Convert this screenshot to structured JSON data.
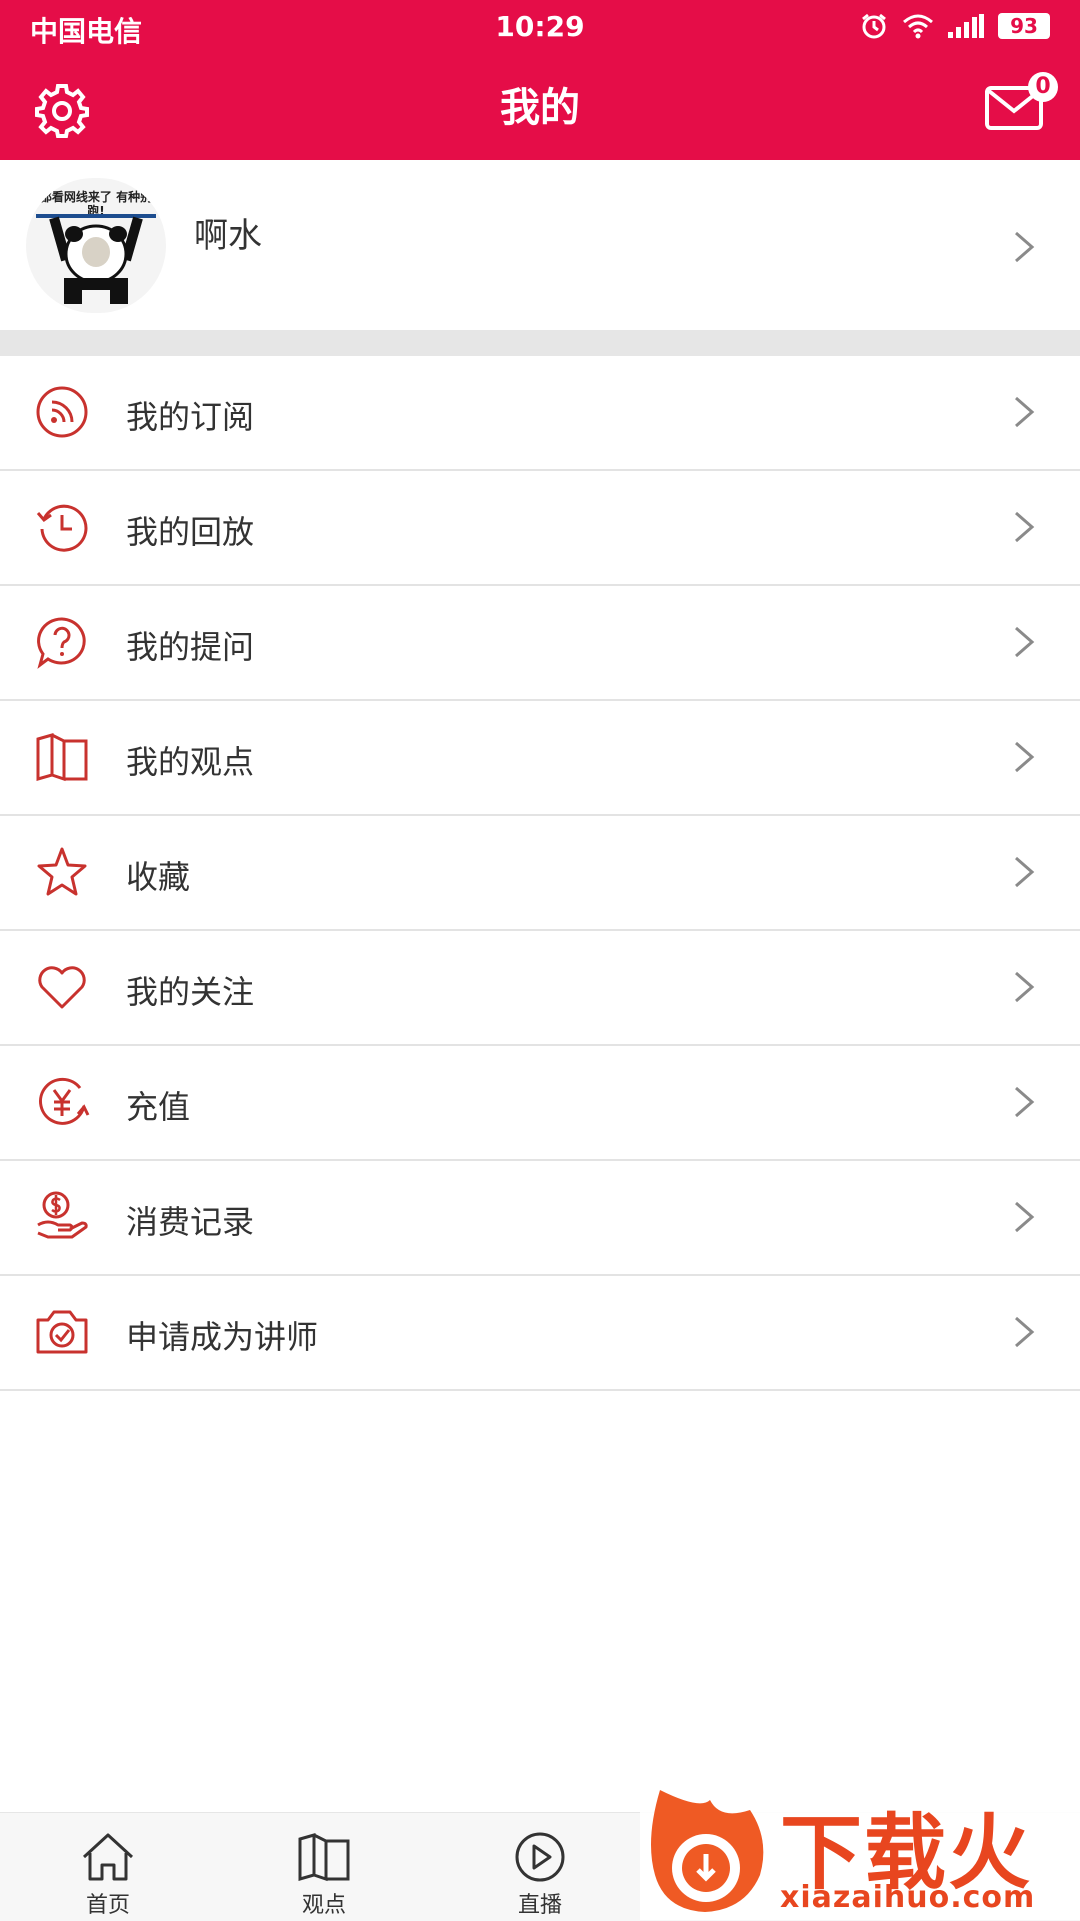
{
  "status_bar": {
    "carrier": "中国电信",
    "time": "10:29",
    "battery": "93"
  },
  "header": {
    "title": "我的",
    "mail_count": "0"
  },
  "profile": {
    "name": "啊水",
    "avatar_caption": "都看网线来了 有种别跑!"
  },
  "menu": [
    {
      "label": "我的订阅",
      "icon": "rss-icon"
    },
    {
      "label": "我的回放",
      "icon": "history-icon"
    },
    {
      "label": "我的提问",
      "icon": "question-icon"
    },
    {
      "label": "我的观点",
      "icon": "book-icon"
    },
    {
      "label": "收藏",
      "icon": "star-icon"
    },
    {
      "label": "我的关注",
      "icon": "heart-icon"
    },
    {
      "label": "充值",
      "icon": "yuan-icon"
    },
    {
      "label": "消费记录",
      "icon": "money-hand-icon"
    },
    {
      "label": "申请成为讲师",
      "icon": "camera-check-icon"
    }
  ],
  "tabbar": [
    {
      "label": "首页",
      "icon": "home-icon"
    },
    {
      "label": "观点",
      "icon": "book-icon"
    },
    {
      "label": "直播",
      "icon": "play-icon"
    }
  ],
  "watermark": {
    "brand": "下载火",
    "url": "xiazaihuo.com"
  },
  "colors": {
    "accent": "#e50d48",
    "icon": "#c8322e"
  }
}
